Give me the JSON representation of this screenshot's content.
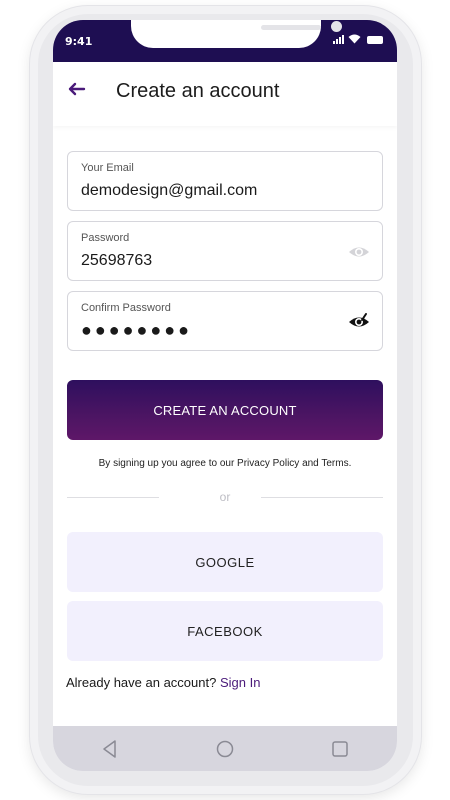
{
  "status_bar": {
    "time": "9:41"
  },
  "header": {
    "title": "Create an account"
  },
  "form": {
    "email": {
      "label": "Your Email",
      "value": "demodesign@gmail.com"
    },
    "password": {
      "label": "Password",
      "value": "25698763"
    },
    "confirm_password": {
      "label": "Confirm Password",
      "value": "●●●●●●●●"
    }
  },
  "actions": {
    "create_label": "CREATE AN ACCOUNT",
    "terms": "By signing up you agree to our Privacy Policy and Terms.",
    "divider": "or",
    "google_label": "GOOGLE",
    "facebook_label": "FACEBOOK"
  },
  "footer": {
    "prompt": "Already have an account?",
    "signin_label": "Sign In"
  },
  "colors": {
    "status_bar": "#1e0e52",
    "accent": "#4a1a7a",
    "button_gradient_start": "#2e0f5e",
    "button_gradient_end": "#5e1768",
    "social_bg": "#f2f0fd",
    "nav_bar": "#d7d6de"
  },
  "icons": {
    "back": "arrow-left-icon",
    "password_visibility": "eye-icon",
    "confirm_visibility": "eye-slash-icon",
    "nav": [
      "triangle-back-icon",
      "circle-home-icon",
      "square-recents-icon"
    ]
  }
}
